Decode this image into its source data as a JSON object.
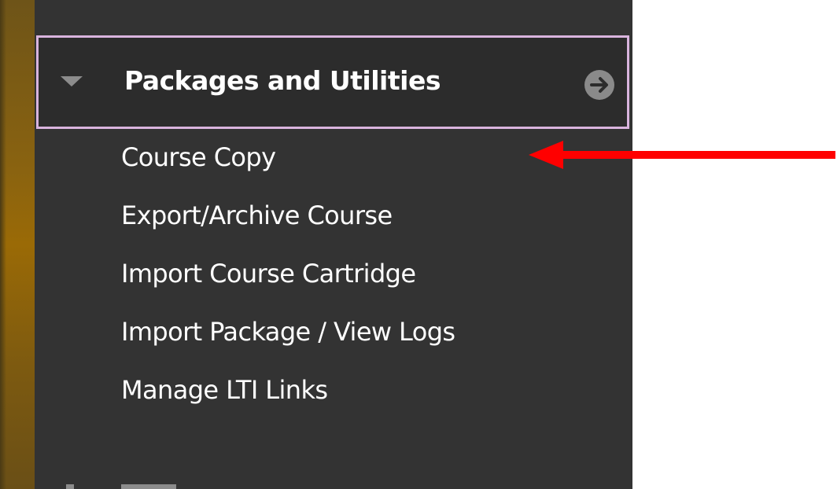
{
  "menu": {
    "title": "Packages and Utilities",
    "items": [
      {
        "label": "Course Copy"
      },
      {
        "label": "Export/Archive Course"
      },
      {
        "label": "Import Course Cartridge"
      },
      {
        "label": "Import Package / View Logs"
      },
      {
        "label": "Manage LTI Links"
      }
    ]
  },
  "colors": {
    "panel": "#333333",
    "header_border": "#d9b4de",
    "side_strip": "#8a6310",
    "annotation_arrow": "#ff0000"
  },
  "icons": {
    "collapse": "caret-down-icon",
    "go": "circle-arrow-right-icon",
    "annotation": "red-pointer-arrow"
  }
}
